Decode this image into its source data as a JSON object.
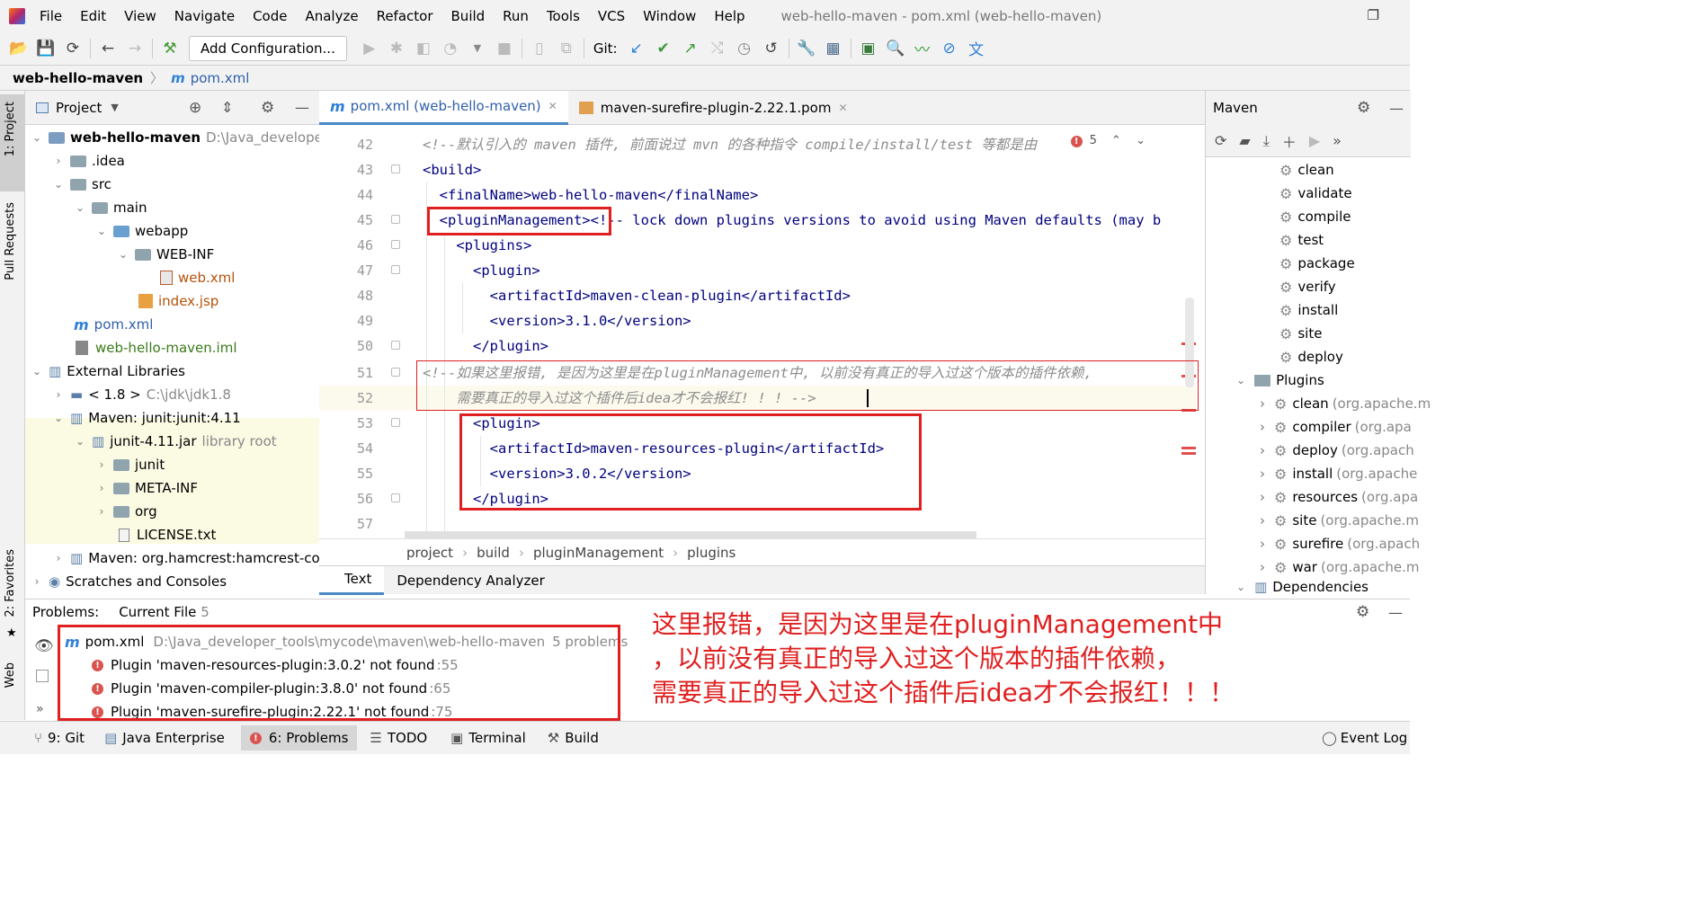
{
  "window": {
    "title": "web-hello-maven - pom.xml (web-hello-maven)"
  },
  "menu": [
    "File",
    "Edit",
    "View",
    "Navigate",
    "Code",
    "Analyze",
    "Refactor",
    "Build",
    "Run",
    "Tools",
    "VCS",
    "Window",
    "Help"
  ],
  "toolbar": {
    "run_config": "Add Configuration...",
    "git_label": "Git:"
  },
  "navbar": {
    "project": "web-hello-maven",
    "file": "pom.xml"
  },
  "left_strip": {
    "project": "1: Project",
    "pull_requests": "Pull Requests",
    "favorites": "2: Favorites",
    "web": "Web"
  },
  "project_panel": {
    "title": "Project",
    "tree": [
      {
        "label": "web-hello-maven",
        "extra": "D:\\Java_developer_to"
      },
      {
        "label": ".idea"
      },
      {
        "label": "src"
      },
      {
        "label": "main"
      },
      {
        "label": "webapp"
      },
      {
        "label": "WEB-INF"
      },
      {
        "label": "web.xml"
      },
      {
        "label": "index.jsp"
      },
      {
        "label": "pom.xml"
      },
      {
        "label": "web-hello-maven.iml"
      },
      {
        "label": "External Libraries"
      },
      {
        "label": "< 1.8 >",
        "extra": "C:\\jdk\\jdk1.8"
      },
      {
        "label": "Maven: junit:junit:4.11"
      },
      {
        "label": "junit-4.11.jar",
        "extra": "library root"
      },
      {
        "label": "junit"
      },
      {
        "label": "META-INF"
      },
      {
        "label": "org"
      },
      {
        "label": "LICENSE.txt"
      },
      {
        "label": "Maven: org.hamcrest:hamcrest-core:"
      },
      {
        "label": "Scratches and Consoles"
      }
    ]
  },
  "editor": {
    "tabs": [
      {
        "label": "pom.xml (web-hello-maven)"
      },
      {
        "label": "maven-surefire-plugin-2.22.1.pom"
      }
    ],
    "error_count": "5",
    "lines": [
      {
        "n": "42",
        "text": "<!--默认引入的 maven 插件, 前面说过 mvn 的各种指令 compile/install/test 等都是由"
      },
      {
        "n": "43",
        "text": "<build>"
      },
      {
        "n": "44",
        "text": "  <finalName>web-hello-maven</finalName>"
      },
      {
        "n": "45",
        "text": "  <pluginManagement><!-- lock down plugins versions to avoid using Maven defaults (may b"
      },
      {
        "n": "46",
        "text": "    <plugins>"
      },
      {
        "n": "47",
        "text": "      <plugin>"
      },
      {
        "n": "48",
        "text": "        <artifactId>maven-clean-plugin</artifactId>"
      },
      {
        "n": "49",
        "text": "        <version>3.1.0</version>"
      },
      {
        "n": "50",
        "text": "      </plugin>"
      },
      {
        "n": "51",
        "text": "<!--如果这里报错, 是因为这里是在pluginManagement中, 以前没有真正的导入过这个版本的插件依赖,"
      },
      {
        "n": "52",
        "text": "    需要真正的导入过这个插件后idea才不会报红! ! ! -->"
      },
      {
        "n": "53",
        "text": "      <plugin>"
      },
      {
        "n": "54",
        "text": "        <artifactId>maven-resources-plugin</artifactId>"
      },
      {
        "n": "55",
        "text": "        <version>3.0.2</version>"
      },
      {
        "n": "56",
        "text": "      </plugin>"
      },
      {
        "n": "57",
        "text": ""
      }
    ],
    "breadcrumb": [
      "project",
      "build",
      "pluginManagement",
      "plugins"
    ],
    "bottom_tabs": [
      "Text",
      "Dependency Analyzer"
    ]
  },
  "maven_panel": {
    "title": "Maven",
    "lifecycle": [
      "clean",
      "validate",
      "compile",
      "test",
      "package",
      "verify",
      "install",
      "site",
      "deploy"
    ],
    "plugins_label": "Plugins",
    "plugins": [
      {
        "name": "clean",
        "group": "(org.apache.m"
      },
      {
        "name": "compiler",
        "group": "(org.apa"
      },
      {
        "name": "deploy",
        "group": "(org.apach"
      },
      {
        "name": "install",
        "group": "(org.apache"
      },
      {
        "name": "resources",
        "group": "(org.apa"
      },
      {
        "name": "site",
        "group": "(org.apache.m"
      },
      {
        "name": "surefire",
        "group": "(org.apach"
      },
      {
        "name": "war",
        "group": "(org.apache.m"
      }
    ],
    "dependencies_label": "Dependencies"
  },
  "problems": {
    "label": "Problems:",
    "current_file": "Current File",
    "current_count": "5",
    "file": "pom.xml",
    "path": "D:\\Java_developer_tools\\mycode\\maven\\web-hello-maven",
    "count": "5 problems",
    "items": [
      {
        "text": "Plugin 'maven-resources-plugin:3.0.2' not found",
        "line": ":55"
      },
      {
        "text": "Plugin 'maven-compiler-plugin:3.8.0' not found",
        "line": ":65"
      },
      {
        "text": "Plugin 'maven-surefire-plugin:2.22.1' not found",
        "line": ":75"
      }
    ]
  },
  "annotation": [
    "这里报错，是因为这里是在pluginManagement中",
    "，以前没有真正的导入过这个版本的插件依赖，",
    "需要真正的导入过这个插件后idea才不会报红！！！"
  ],
  "statusbar": [
    "9: Git",
    "Java Enterprise",
    "6: Problems",
    "TODO",
    "Terminal",
    "Build",
    "Event Log"
  ],
  "colors": {
    "annotation_red": "#e02020",
    "tag_blue": "#000080",
    "comment_gray": "#8c8c8c"
  }
}
